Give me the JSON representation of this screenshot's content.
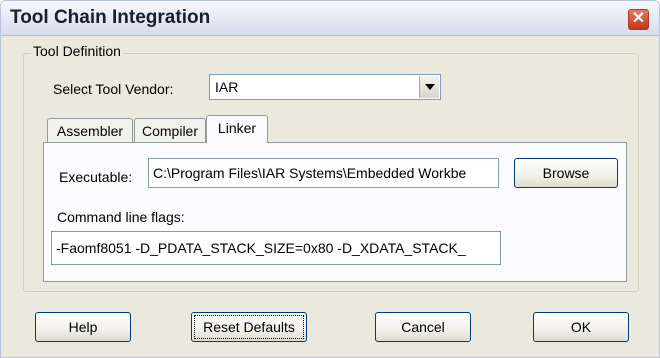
{
  "window": {
    "title": "Tool Chain Integration",
    "close_glyph": "✕"
  },
  "group": {
    "label": "Tool Definition"
  },
  "vendor": {
    "label": "Select Tool Vendor:",
    "value": "IAR"
  },
  "tabs": [
    {
      "label": "Assembler",
      "active": false
    },
    {
      "label": "Compiler",
      "active": false
    },
    {
      "label": "Linker",
      "active": true
    }
  ],
  "linker": {
    "executable_label": "Executable:",
    "executable_value": "C:\\Program Files\\IAR Systems\\Embedded Workbe",
    "browse_label": "Browse",
    "flags_label": "Command line flags:",
    "flags_value": "-Faomf8051 -D_PDATA_STACK_SIZE=0x80 -D_XDATA_STACK_"
  },
  "buttons": {
    "help": "Help",
    "reset": "Reset Defaults",
    "cancel": "Cancel",
    "ok": "OK"
  }
}
